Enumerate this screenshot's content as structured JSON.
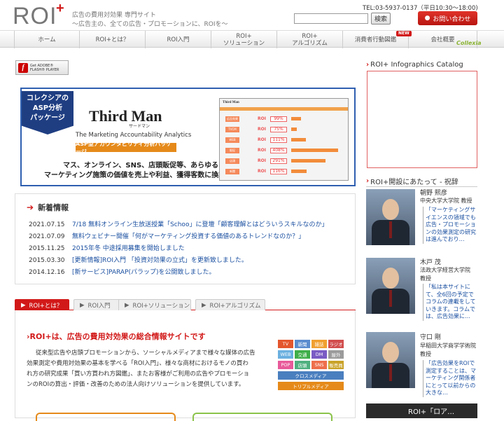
{
  "header": {
    "logo_text": "ROI",
    "logo_plus": "+",
    "tagline1": "広告の費用対効果 専門サイト",
    "tagline2": "〜広告主の、全ての広告・プロモーションに、ROIを〜",
    "tel": "TEL:03-5937-0137（平日10:30〜18:00)",
    "search_placeholder": "",
    "search_button": "検索",
    "contact_button": "お問い合わせ"
  },
  "nav": {
    "items": [
      {
        "label": "ホーム"
      },
      {
        "label": "ROI+とは？"
      },
      {
        "label": "ROI入門"
      },
      {
        "label": "ROI+",
        "label2": "ソリューション"
      },
      {
        "label": "ROI+",
        "label2": "アルゴリズム"
      },
      {
        "label": "消費者行動図鑑"
      },
      {
        "label": "会社概要"
      }
    ],
    "new_badge": "NEW",
    "collexia": "Collexia"
  },
  "flash": {
    "line1": "Get ADOBE®",
    "line2": "FLASH® PLAYER"
  },
  "banner": {
    "badge": [
      "コレクシアの",
      "ASP分析",
      "パッケージ"
    ],
    "title": "Third Man",
    "title_kana": "サードマン",
    "subtitle": "The Marketing Accountability Analytics",
    "asp_label": "ASP型アカウンタビリティ分析パッケージ",
    "copy1": "マス、オンライン、SNS、店頭販促等、あらゆる",
    "copy2": "マーケティング施策の価値を売上や利益、獲得客数に換算。",
    "screen_rows": [
      {
        "tag": "広告効果",
        "val": "99%",
        "bar": 0.2
      },
      {
        "tag": "TVCM",
        "val": "75%",
        "bar": 0.12
      },
      {
        "tag": "WEB",
        "val": "111%",
        "bar": 0.3
      },
      {
        "tag": "販促",
        "val": "408%",
        "bar": 0.95
      },
      {
        "tag": "店頭",
        "val": "291%",
        "bar": 0.7
      },
      {
        "tag": "新聞",
        "val": "116%",
        "bar": 0.32
      }
    ],
    "screen_roi": "ROI"
  },
  "news": {
    "title": "新着情報",
    "items": [
      {
        "date": "2021.07.15",
        "text": "7/18 無料オンライン生放送授業「Schoo」に登壇「顧客理解とはどういうスキルなのか」"
      },
      {
        "date": "2021.07.09",
        "text": "無料ウェビナー開催「何がマーケティング投資する価値のあるトレンドなのか？」"
      },
      {
        "date": "2015.11.25",
        "text": "2015年冬 中途採用募集を開始しました"
      },
      {
        "date": "2015.03.30",
        "text": "[更新情報]ROI入門 「投資対効果の立式」を更新致しました。"
      },
      {
        "date": "2014.12.16",
        "text": "[新サービス]PARAP(パラップ)を公開致しました。"
      }
    ]
  },
  "tabs": [
    {
      "label": "ROI+とは？"
    },
    {
      "label": "ROI入門"
    },
    {
      "label": "ROI+ソリューション"
    },
    {
      "label": "ROI+アルゴリズム"
    }
  ],
  "intro": {
    "title": "ROI+は、広告の費用対効果の総合情報サイトです",
    "lines": [
      "従来型広告や店頭プロモーションから、ソーシャルメディアまで様々な媒体の広告",
      "効果測定や費用対効果の基本を学べる「ROI入門」、様々な商材におけるモノの買わ",
      "れ方の研究成果「買い方買われ方図鑑」、またお客様がご利用の広告やプロモーショ",
      "ンのROIの算出・評価・改善のための法人向けソリューションを提供しています。"
    ],
    "media": [
      "TV",
      "新聞",
      "雑誌",
      "ラジオ",
      "WEB",
      "交通",
      "DM",
      "屋外",
      "POP",
      "店頭",
      "SNS",
      "販売員",
      "クロスメディア",
      "トリプルメディア"
    ]
  },
  "right": {
    "catalog_title": "ROI+ Infographics Catalog",
    "greetings_title": "ROI+開設にあたって - 祝辞",
    "people": [
      {
        "name": "朝野 熙彦",
        "role": "中央大学大学院 教授",
        "quote": "「マーケティングサイエンスの領域でも広告・プロモーションの効果測定の研究は進んでおり…"
      },
      {
        "name": "木戸 茂",
        "role": "法政大学経営大学院",
        "role2": "教授",
        "quote": "「私は本サイトにて、全6回の予定でコラムの連載をしていきます。コラムでは、広告効果に…"
      },
      {
        "name": "守口 剛",
        "role": "早稲田大学商学学術院",
        "role2": "教授",
        "quote": "「広告効果をROIで測定することは、マーケティング関係者にとって以前からの大きな…"
      }
    ],
    "bottom_banner": "ROI+「ロア…"
  },
  "colors": {
    "accent": "#d21919",
    "link": "#1a4fa0",
    "banner_border": "#2f5fb0",
    "orange": "#e58a1a"
  }
}
